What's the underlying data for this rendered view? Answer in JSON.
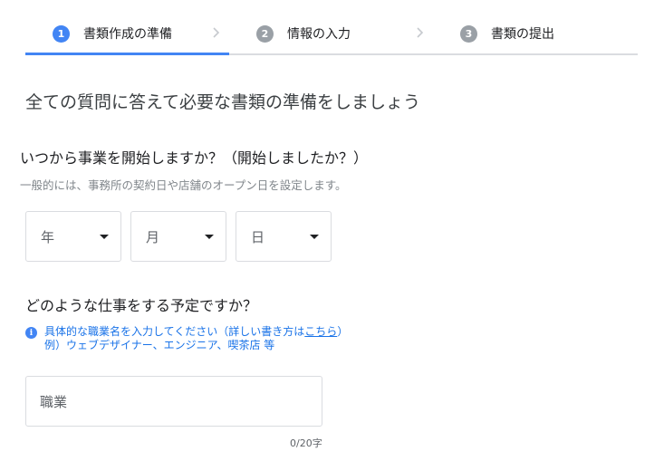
{
  "stepper": {
    "steps": [
      {
        "number": "1",
        "label": "書類作成の準備",
        "state": "active"
      },
      {
        "number": "2",
        "label": "情報の入力",
        "state": "inactive"
      },
      {
        "number": "3",
        "label": "書類の提出",
        "state": "inactive"
      }
    ]
  },
  "page": {
    "title": "全ての質問に答えて必要な書類の準備をしましょう"
  },
  "start_date_question": {
    "title": "いつから事業を開始しますか？（開始しましたか？）",
    "help": "一般的には、事務所の契約日や店舗のオープン日を設定します。",
    "year_select": "年",
    "month_select": "月",
    "day_select": "日"
  },
  "job_question": {
    "title": "どのような仕事をする予定ですか？",
    "info_line1_before_link": "具体的な職業名を入力してください（詳しい書き方は",
    "info_link": "こちら",
    "info_line1_after_link": "）",
    "info_line2": "例）ウェブデザイナー、エンジニア、喫茶店 等",
    "input_placeholder": "職業",
    "char_count": "0/20字"
  },
  "colors": {
    "accent": "#4285f4",
    "inactive_step": "#9aa0a6",
    "link": "#1a73e8"
  }
}
